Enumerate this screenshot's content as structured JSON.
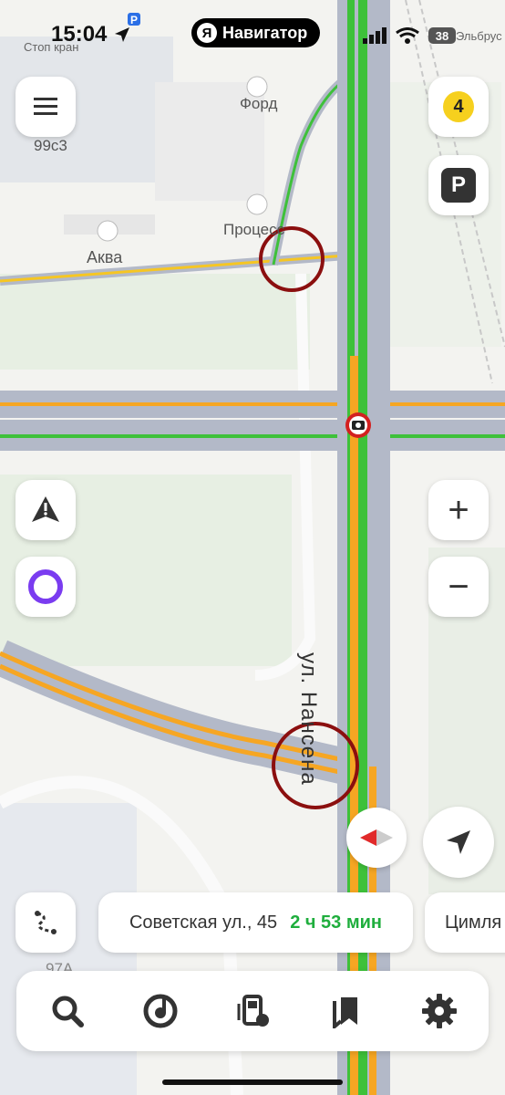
{
  "status_bar": {
    "time": "15:04",
    "battery": "38",
    "app_name": "Навигатор",
    "yandex_logo": "Я"
  },
  "map": {
    "pois": [
      {
        "label": "Стоп кран"
      },
      {
        "label": "99с3"
      },
      {
        "label": "Форд"
      },
      {
        "label": "Аква"
      },
      {
        "label": "Процесс"
      },
      {
        "label": "Эльбрус"
      },
      {
        "label": "97А"
      }
    ],
    "street_label": "ул. Нансена"
  },
  "controls": {
    "traffic_level": "4",
    "parking_label": "P",
    "zoom_in_label": "+",
    "zoom_out_label": "−"
  },
  "route": {
    "address": "Советская ул., 45",
    "eta": "2 ч 53 мин",
    "alt_destination": "Цимля"
  },
  "bottom_bar": {
    "icons": [
      "search-icon",
      "music-icon",
      "gas-station-icon",
      "bookmarks-icon",
      "settings-icon"
    ]
  },
  "colors": {
    "traffic_yellow": "#f6d01e",
    "route_green": "#3ec13a",
    "route_orange": "#f6a623",
    "eta_green": "#1fae3d",
    "alert_circle": "#8b0f0f",
    "alice_purple": "#7a3cf0"
  }
}
